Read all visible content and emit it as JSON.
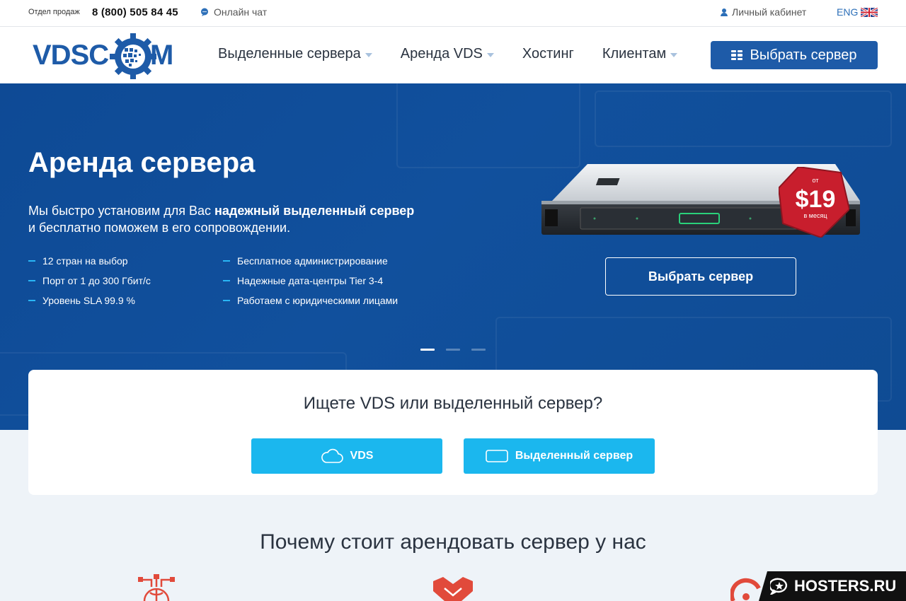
{
  "topbar": {
    "sales_label": "Отдел продаж",
    "phone": "8 (800) 505 84 45",
    "chat": "Онлайн чат",
    "cabinet": "Личный кабинет",
    "lang": "ENG"
  },
  "header": {
    "logo_text": "VDSCOM",
    "nav": [
      "Выделенные сервера",
      "Аренда VDS",
      "Хостинг",
      "Клиентам"
    ],
    "cta": "Выбрать сервер"
  },
  "hero": {
    "title": "Аренда сервера",
    "lead_plain_1": "Мы быстро установим для Вас ",
    "lead_bold": "надежный выделенный сервер",
    "lead_plain_2": "и бесплатно поможем в его сопровождении.",
    "features_left": [
      "12 стран на выбор",
      "Порт от 1 до 300 Гбит/с",
      "Уровень SLA 99.9 %"
    ],
    "features_right": [
      "Бесплатное администрирование",
      "Надежные дата-центры Tier 3-4",
      "Работаем с юридическими лицами"
    ],
    "badge_from": "от",
    "badge_price": "$19",
    "badge_period": "в месяц",
    "button": "Выбрать сервер",
    "slides_total": 3,
    "slide_active": 1
  },
  "search": {
    "question": "Ищете VDS или выделенный сервер?",
    "vds": "VDS",
    "dedicated": "Выделенный сервер"
  },
  "why": {
    "title": "Почему стоит арендовать сервер у нас"
  },
  "watermark": "HOSTERS.RU",
  "colors": {
    "brand": "#1e5ba8",
    "accent": "#1bb7ee",
    "hero": "#11509d",
    "badge": "#c81e2d",
    "icons": "#e14a3b"
  }
}
